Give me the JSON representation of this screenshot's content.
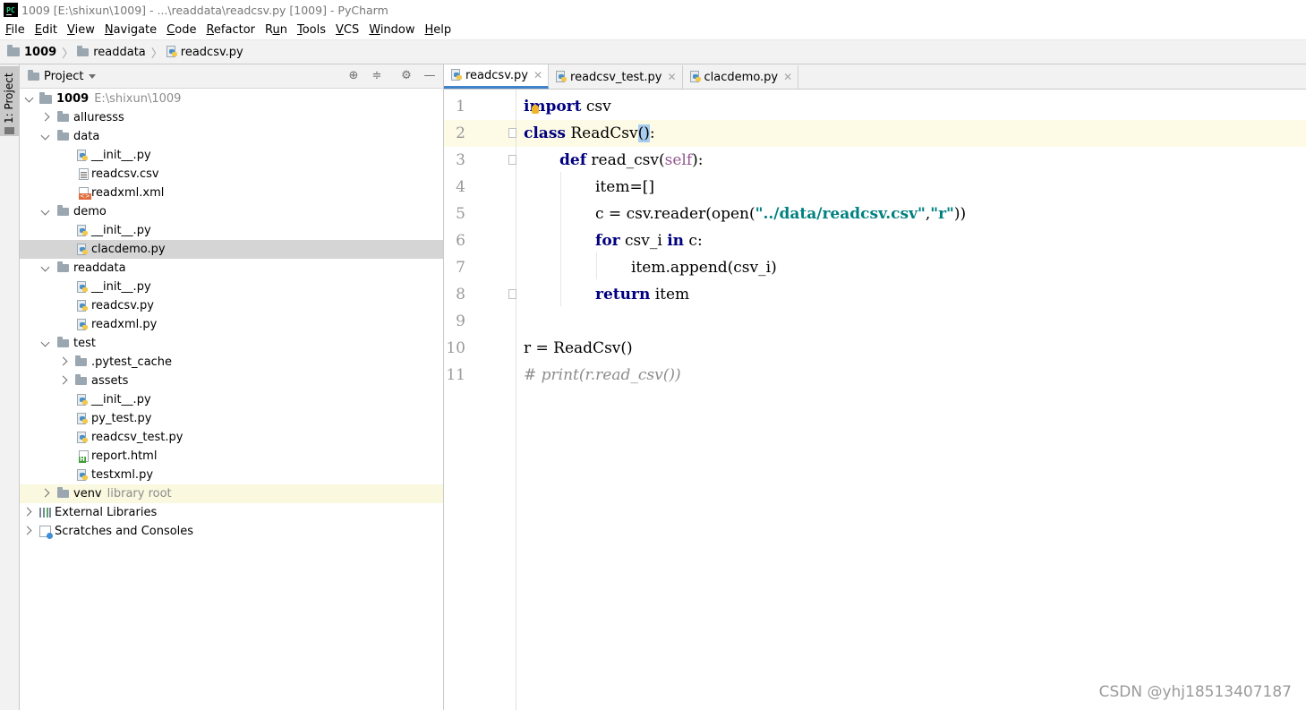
{
  "window": {
    "title": "1009 [E:\\shixun\\1009] - ...\\readdata\\readcsv.py [1009] - PyCharm"
  },
  "menu": [
    {
      "mn": "F",
      "rest": "ile"
    },
    {
      "mn": "E",
      "rest": "dit"
    },
    {
      "mn": "V",
      "rest": "iew"
    },
    {
      "mn": "N",
      "rest": "avigate"
    },
    {
      "mn": "C",
      "rest": "ode"
    },
    {
      "mn": "R",
      "rest": "efactor"
    },
    {
      "mn": "R",
      "rest": "un",
      "mn_after": true,
      "pre": "R",
      "u": "u",
      "post": "n"
    },
    {
      "mn": "T",
      "rest": "ools"
    },
    {
      "mn": "V",
      "rest": "CS"
    },
    {
      "mn": "W",
      "rest": "indow"
    },
    {
      "mn": "H",
      "rest": "elp"
    }
  ],
  "breadcrumb": [
    "1009",
    "readdata",
    "readcsv.py"
  ],
  "toolstrip": {
    "label": "1: Project"
  },
  "project_panel": {
    "title": "Project",
    "tree": [
      {
        "label": "1009",
        "extra": "E:\\shixun\\1009"
      },
      {
        "label": "alluresss"
      },
      {
        "label": "data"
      },
      {
        "label": "__init__.py"
      },
      {
        "label": "readcsv.csv"
      },
      {
        "label": "readxml.xml"
      },
      {
        "label": "demo"
      },
      {
        "label": "__init__.py"
      },
      {
        "label": "clacdemo.py"
      },
      {
        "label": "readdata"
      },
      {
        "label": "__init__.py"
      },
      {
        "label": "readcsv.py"
      },
      {
        "label": "readxml.py"
      },
      {
        "label": "test"
      },
      {
        "label": ".pytest_cache"
      },
      {
        "label": "assets"
      },
      {
        "label": "__init__.py"
      },
      {
        "label": "py_test.py"
      },
      {
        "label": "readcsv_test.py"
      },
      {
        "label": "report.html"
      },
      {
        "label": "testxml.py"
      },
      {
        "label": "venv",
        "extra": "library root"
      },
      {
        "label": "External Libraries"
      },
      {
        "label": "Scratches and Consoles"
      }
    ]
  },
  "editor_tabs": [
    "readcsv.py",
    "readcsv_test.py",
    "clacdemo.py"
  ],
  "line_numbers": [
    "1",
    "2",
    "3",
    "4",
    "5",
    "6",
    "7",
    "8",
    "9",
    "10",
    "11"
  ],
  "code": {
    "l1_kw": "import",
    "l1_rest": " csv",
    "l2_kw": "class",
    "l2_name": " ReadCsv",
    "l2_paren": "()",
    "l2_colon": ":",
    "l3_kw": "def",
    "l3_name": " read_csv(",
    "l3_self": "self",
    "l3_end": "):",
    "l4": "item=[]",
    "l5_a": "c = csv.reader(open(",
    "l5_s1": "\"../data/readcsv.csv\"",
    "l5_comma": ",",
    "l5_s2": "\"r\"",
    "l5_end": "))",
    "l6_kw1": "for",
    "l6_mid": " csv_i ",
    "l6_kw2": "in",
    "l6_end": " c:",
    "l7": "item.append(csv_i)",
    "l8_kw": "return",
    "l8_rest": " item",
    "l10": "r = ReadCsv()",
    "l11": "# print(r.read_csv())"
  },
  "watermark": "CSDN @yhj18513407187"
}
